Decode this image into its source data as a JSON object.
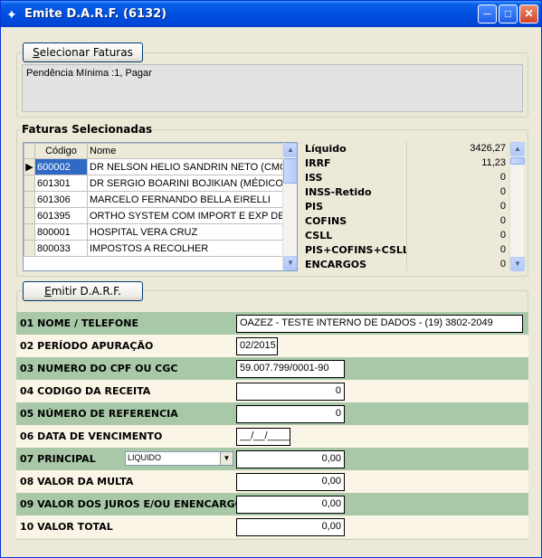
{
  "window": {
    "title": "Emite D.A.R.F. (6132)"
  },
  "top_button": {
    "prefix": "S",
    "rest": "elecionar Faturas"
  },
  "pending_text": "Pendência Mínima :1, Pagar",
  "faturas": {
    "title": "Faturas Selecionadas",
    "columns": [
      "Código",
      "Nome"
    ],
    "rows": [
      {
        "code": "600002",
        "name": "DR NELSON HELIO SANDRIN NETO (CMC)"
      },
      {
        "code": "601301",
        "name": "DR SERGIO BOARINI BOJIKIAN (MÉDICO)"
      },
      {
        "code": "601306",
        "name": "MARCELO FERNANDO BELLA EIRELLI"
      },
      {
        "code": "601395",
        "name": "ORTHO SYSTEM COM IMPORT E EXP DE IMP"
      },
      {
        "code": "800001",
        "name": "HOSPITAL VERA CRUZ"
      },
      {
        "code": "800033",
        "name": "IMPOSTOS A RECOLHER"
      }
    ]
  },
  "totals": [
    {
      "label": "Líquido",
      "value": "3426,27"
    },
    {
      "label": "IRRF",
      "value": "11,23"
    },
    {
      "label": "ISS",
      "value": "0"
    },
    {
      "label": "INSS-Retido",
      "value": "0"
    },
    {
      "label": "PIS",
      "value": "0"
    },
    {
      "label": "COFINS",
      "value": "0"
    },
    {
      "label": "CSLL",
      "value": "0"
    },
    {
      "label": "PIS+COFINS+CSLL",
      "value": "0"
    },
    {
      "label": "ENCARGOS",
      "value": "0"
    }
  ],
  "emit_button": {
    "prefix": "E",
    "rest": "mitir D.A.R.F."
  },
  "form": [
    {
      "label": "01 NOME / TELEFONE",
      "value": "OAZEZ - TESTE INTERNO DE DADOS - (19) 3802-2049"
    },
    {
      "label": "02 PERÍODO APURAÇÃO",
      "value": "02/2015"
    },
    {
      "label": "03 NUMERO DO CPF OU CGC",
      "value": "59.007.799/0001-90"
    },
    {
      "label": "04 CODIGO DA RECEITA",
      "value": "0"
    },
    {
      "label": "05 NÚMERO DE REFERENCIA",
      "value": "0"
    },
    {
      "label": "06 DATA DE VENCIMENTO",
      "value": "__/__/____"
    },
    {
      "label": "07 PRINCIPAL",
      "value": "0,00",
      "combo": "LIQUIDO"
    },
    {
      "label": "08 VALOR DA MULTA",
      "value": "0,00"
    },
    {
      "label": "09 VALOR DOS JUROS E/OU ENENCARGOS",
      "value": "0,00"
    },
    {
      "label": "10 VALOR TOTAL",
      "value": "0,00"
    }
  ]
}
